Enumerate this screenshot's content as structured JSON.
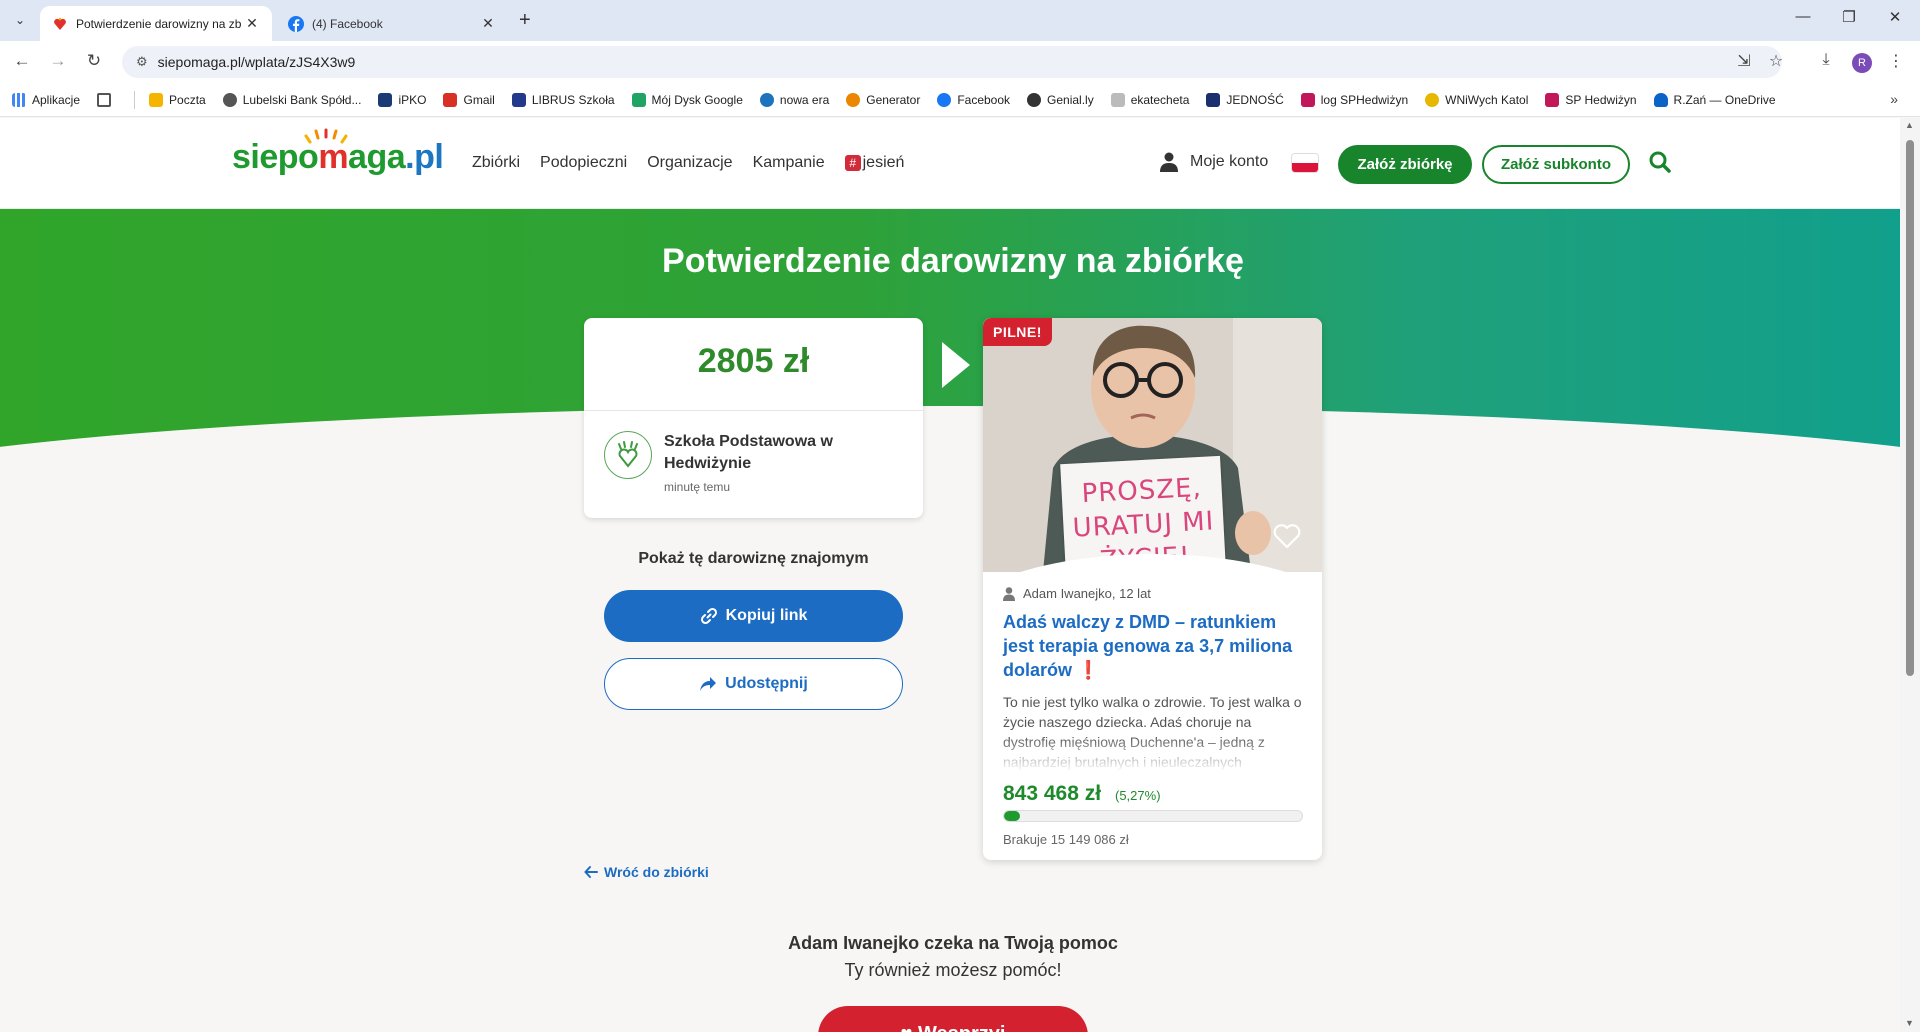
{
  "browser": {
    "tabs": [
      {
        "title": "Potwierdzenie darowizny na zb",
        "active": true
      },
      {
        "title": "(4) Facebook",
        "active": false
      }
    ],
    "url": "siepomaga.pl/wplata/zJS4X3w9",
    "profile_initial": "R",
    "bookmarks": [
      {
        "label": "Aplikacje",
        "icon": "apps-grid-icon",
        "color": "#4285f4"
      },
      {
        "label": "Poczta",
        "icon": "mail-icon",
        "color": "#f4b400"
      },
      {
        "label": "Lubelski Bank Spółd...",
        "icon": "bank-icon",
        "color": "#555555"
      },
      {
        "label": "iPKO",
        "icon": "pko-icon",
        "color": "#1a3b73"
      },
      {
        "label": "Gmail",
        "icon": "gmail-icon",
        "color": "#d93025"
      },
      {
        "label": "LIBRUS Szkoła",
        "icon": "librus-icon",
        "color": "#233a8c"
      },
      {
        "label": "Mój Dysk Google",
        "icon": "drive-icon",
        "color": "#1fa463"
      },
      {
        "label": "nowa era",
        "icon": "nowa-era-icon",
        "color": "#1e73be"
      },
      {
        "label": "Generator",
        "icon": "generator-icon",
        "color": "#ea8600"
      },
      {
        "label": "Facebook",
        "icon": "facebook-icon",
        "color": "#1877f2"
      },
      {
        "label": "Genial.ly",
        "icon": "genially-icon",
        "color": "#333333"
      },
      {
        "label": "ekatecheta",
        "icon": "ekatecheta-icon",
        "color": "#bbbbbb"
      },
      {
        "label": "JEDNOŚĆ",
        "icon": "jednosc-icon",
        "color": "#1b2e6e"
      },
      {
        "label": "log SPHedwiżyn",
        "icon": "school-logo-icon",
        "color": "#c2185b"
      },
      {
        "label": "WNiWych Katol",
        "icon": "sun-icon",
        "color": "#e6b800"
      },
      {
        "label": "SP Hedwiżyn",
        "icon": "school-logo-icon",
        "color": "#c2185b"
      },
      {
        "label": "R.Zań — OneDrive",
        "icon": "onedrive-icon",
        "color": "#0a64c8"
      }
    ]
  },
  "site": {
    "logo": {
      "part1": "siepo",
      "part2": "m",
      "part3": "aga",
      "part4": ".pl"
    },
    "nav": [
      "Zbiórki",
      "Podopieczni",
      "Organizacje",
      "Kampanie",
      "jesień"
    ],
    "account": "Moje konto",
    "btn_create": "Załóż zbiórkę",
    "btn_sub": "Załóż subkonto"
  },
  "hero": {
    "title": "Potwierdzenie darowizny na zbiórkę"
  },
  "donation": {
    "amount": "2805 zł",
    "org_name": "Szkoła Podstawowa w Hedwiżynie",
    "time": "minutę temu"
  },
  "share": {
    "title": "Pokaż tę darowiznę znajomym",
    "copy": "Kopiuj link",
    "share": "Udostępnij",
    "back": "Wróć do zbiórki"
  },
  "campaign": {
    "badge": "PILNE!",
    "sign_lines": [
      "PROSZĘ,",
      "URATUJ MI",
      "ŻYCIE!"
    ],
    "author": "Adam Iwanejko, 12 lat",
    "title": "Adaś walczy z DMD – ratunkiem jest terapia genowa za 3,7 miliona dolarów",
    "title_mark": "❗",
    "description": "To nie jest tylko walka o zdrowie. To jest walka o życie naszego dziecka. Adaś choruje na dystrofię mięśniową Duchenne'a – jedną z najbardziej brutalnych i nieuleczalnych",
    "raised": "843 468 zł",
    "percent_label": "(5,27%)",
    "progress": 0.0527,
    "missing": "Brakuje 15 149 086 zł"
  },
  "footer": {
    "waits": "Adam Iwanejko czeka na Twoją pomoc",
    "also": "Ty również możesz pomóc!",
    "support_btn": "Wesprzyj"
  },
  "colors": {
    "brand_green": "#18842c",
    "link_blue": "#1c6cc4",
    "urgent_red": "#d3212f"
  }
}
